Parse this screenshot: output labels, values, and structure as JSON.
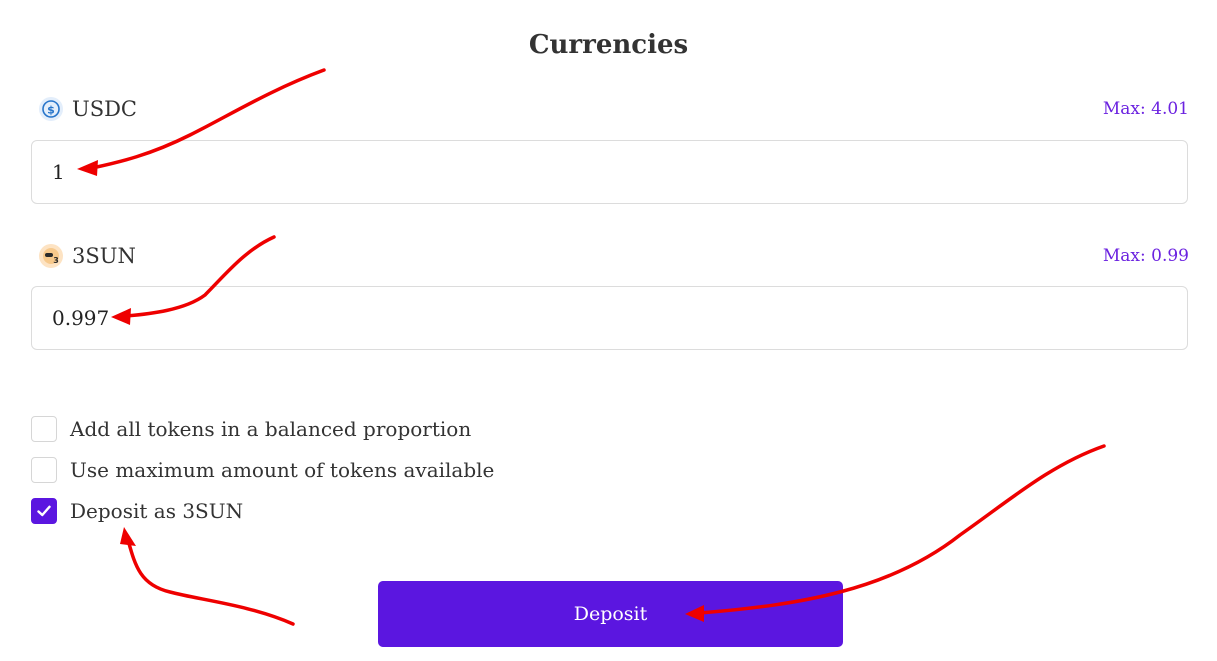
{
  "section": {
    "title": "Currencies"
  },
  "tokens": [
    {
      "symbol": "USDC",
      "icon": "usdc-coin-icon",
      "max_label": "Max: 4.01",
      "amount": "1"
    },
    {
      "symbol": "3SUN",
      "icon": "3sun-coin-icon",
      "max_label": "Max: 0.99",
      "amount": "0.997"
    }
  ],
  "options": [
    {
      "label": "Add all tokens in a balanced proportion",
      "checked": false
    },
    {
      "label": "Use maximum amount of tokens available",
      "checked": false
    },
    {
      "label": "Deposit as 3SUN",
      "checked": true
    }
  ],
  "actions": {
    "deposit_label": "Deposit"
  },
  "colors": {
    "accent": "#5b16e0",
    "max_link": "#6b22e0",
    "annotation_arrow": "#ee0000"
  }
}
